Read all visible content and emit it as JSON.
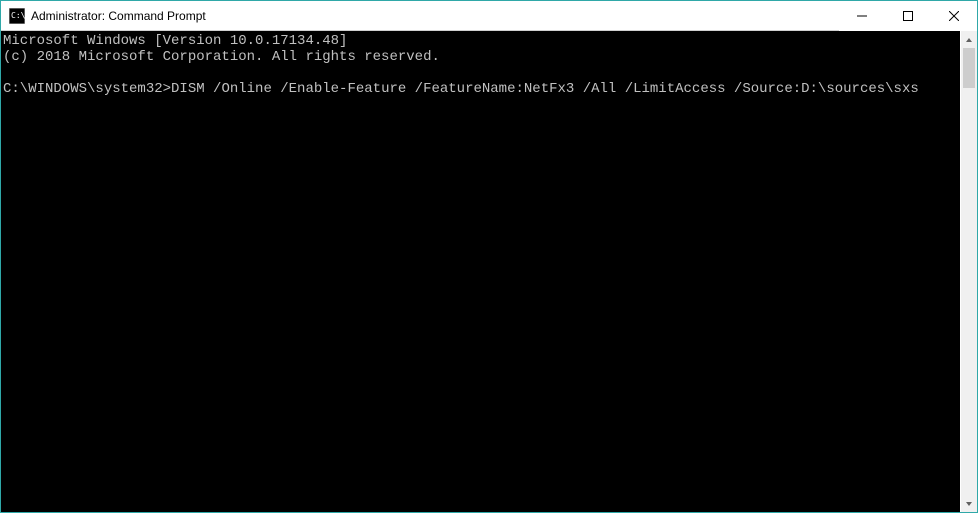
{
  "window": {
    "title": "Administrator: Command Prompt"
  },
  "terminal": {
    "line1": "Microsoft Windows [Version 10.0.17134.48]",
    "line2": "(c) 2018 Microsoft Corporation. All rights reserved.",
    "blank": "",
    "prompt": "C:\\WINDOWS\\system32>",
    "command": "DISM /Online /Enable-Feature /FeatureName:NetFx3 /All /LimitAccess /Source:D:\\sources\\sxs"
  }
}
